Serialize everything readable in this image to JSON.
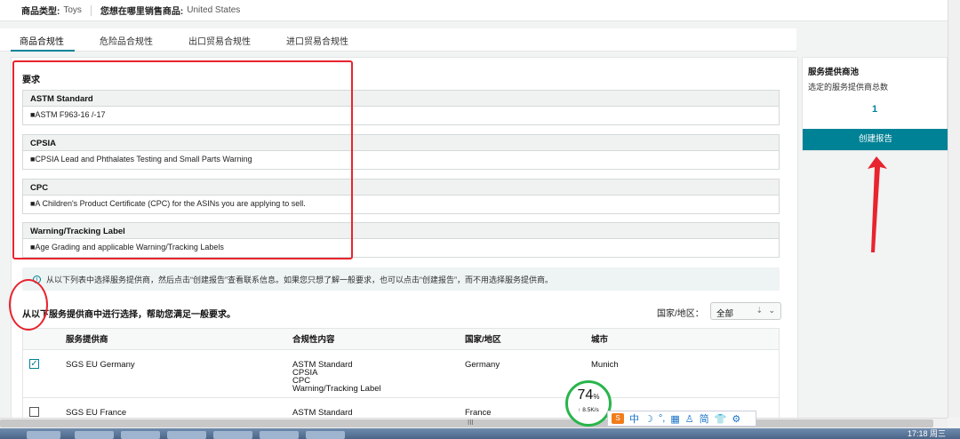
{
  "topbar": {
    "product_type_label": "商品类型:",
    "product_type_value": "Toys",
    "sell_where_label": "您想在哪里销售商品:",
    "sell_where_value": "United States"
  },
  "tabs": [
    {
      "label": "商品合规性",
      "active": true
    },
    {
      "label": "危险品合规性",
      "active": false
    },
    {
      "label": "出口贸易合规性",
      "active": false
    },
    {
      "label": "进口贸易合规性",
      "active": false
    }
  ],
  "requirements": {
    "title": "要求",
    "items": [
      {
        "header": "ASTM Standard",
        "body": "■ASTM F963-16 /-17"
      },
      {
        "header": "CPSIA",
        "body": "■CPSIA Lead and Phthalates Testing and Small Parts Warning"
      },
      {
        "header": "CPC",
        "body": "■A Children's Product Certificate (CPC) for the ASINs you are applying to sell."
      },
      {
        "header": "Warning/Tracking Label",
        "body": "■Age Grading and applicable Warning/Tracking Labels"
      }
    ]
  },
  "info_message": "从以下列表中选择服务提供商，然后点击“创建报告”查看联系信息。如果您只想了解一般要求，也可以点击“创建报告”，而不用选择服务提供商。",
  "selection": {
    "title": "从以下服务提供商中进行选择，帮助您满足一般要求。",
    "country_label": "国家/地区：",
    "country_value": "全部"
  },
  "table": {
    "headers": [
      "服务提供商",
      "合规性内容",
      "国家/地区",
      "城市"
    ],
    "rows": [
      {
        "checked": true,
        "provider": "SGS EU Germany",
        "compliance": [
          "ASTM Standard",
          "CPSIA",
          "CPC",
          "Warning/Tracking Label"
        ],
        "country": "Germany",
        "city": "Munich"
      },
      {
        "checked": false,
        "provider": "SGS EU France",
        "compliance": [
          "ASTM Standard"
        ],
        "country": "France",
        "city": ""
      }
    ]
  },
  "provider_pool": {
    "title": "服务提供商池",
    "subtitle": "选定的服务提供商总数",
    "count": "1",
    "create_button": "创建报告"
  },
  "scrollbar_grip": "III",
  "overlay": {
    "percent": "74",
    "percent_unit": "%",
    "rate": "↑ 8.5K/s",
    "ime_chars": [
      "中",
      "☽",
      "°,",
      "▦",
      "♙",
      "简",
      "👕",
      "⚙"
    ]
  },
  "taskbar": {
    "clock": "17:18 周三"
  },
  "colors": {
    "accent": "#008296",
    "annotation_red": "#e8242f"
  }
}
